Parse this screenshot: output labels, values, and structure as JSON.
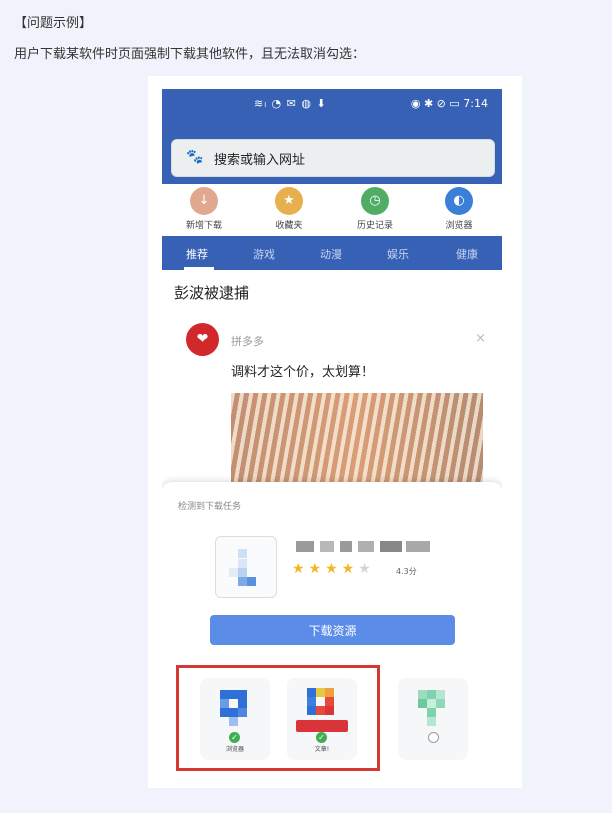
{
  "doc": {
    "heading": "【问题示例】",
    "description": "用户下载某软件时页面强制下载其他软件，且无法取消勾选："
  },
  "phone": {
    "status_left": "≋ₗ ◔ ✉ ◍ ⬇",
    "status_right": "◉ ✱ ⊘ ▭ 7:14",
    "search_placeholder": "搜索或输入网址",
    "shortcuts": [
      {
        "label": "新增下载",
        "icon": "download-circle-icon",
        "color": "#e0a98f"
      },
      {
        "label": "收藏夹",
        "icon": "bookmark-icon",
        "color": "#e6b04c"
      },
      {
        "label": "历史记录",
        "icon": "history-clock-icon",
        "color": "#4fae64"
      },
      {
        "label": "浏览器",
        "icon": "browser-icon",
        "color": "#3b7fd6"
      }
    ],
    "tabs": [
      "推荐",
      "游戏",
      "动漫",
      "娱乐",
      "健康"
    ],
    "news_title": "彭波被逮捕",
    "ad": {
      "source": "拼多多",
      "text": "调料才这个价，太划算！",
      "close": "×"
    },
    "popup": {
      "title": "检测到下载任务",
      "rating": "4.3分",
      "stars_filled": 4,
      "stars_total": 5,
      "download_button": "下载资源",
      "bundled_apps": [
        {
          "label": "浏览器",
          "checked": true
        },
        {
          "label": "文章!",
          "checked": true
        },
        {
          "label": "",
          "checked": false
        }
      ]
    }
  }
}
